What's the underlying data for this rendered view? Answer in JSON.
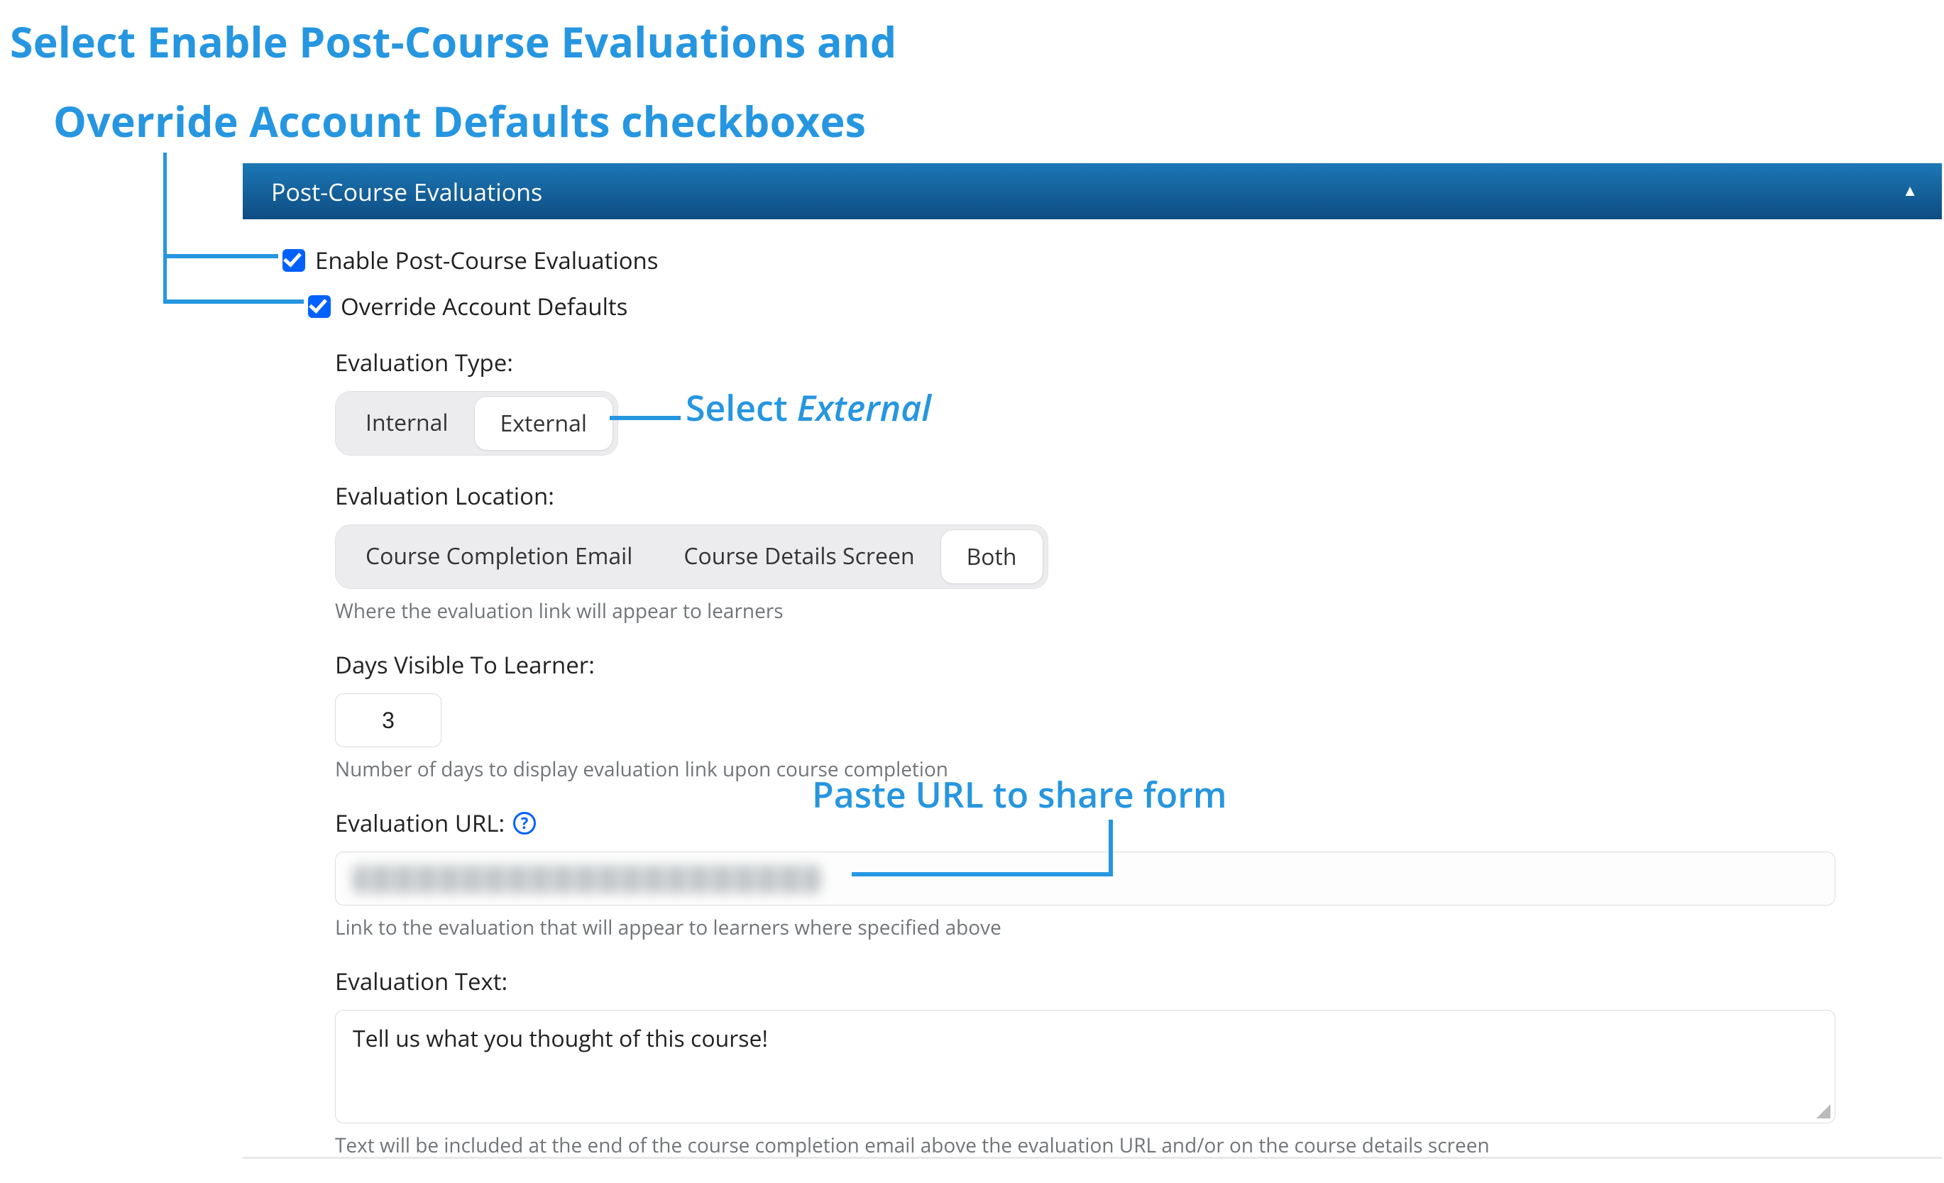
{
  "annotations": {
    "title_line1": "Select Enable Post-Course Evaluations and",
    "title_line2": "Override Account Defaults checkboxes",
    "select_external_prefix": "Select ",
    "select_external_em": "External",
    "paste_url": "Paste URL to share form"
  },
  "panel": {
    "title": "Post-Course Evaluations"
  },
  "checkboxes": {
    "enable_label": "Enable Post-Course Evaluations",
    "override_label": "Override Account Defaults"
  },
  "evaluation_type": {
    "label": "Evaluation Type:",
    "options": {
      "internal": "Internal",
      "external": "External"
    },
    "selected": "external"
  },
  "evaluation_location": {
    "label": "Evaluation Location:",
    "options": {
      "email": "Course Completion Email",
      "details": "Course Details Screen",
      "both": "Both"
    },
    "selected": "both",
    "help": "Where the evaluation link will appear to learners"
  },
  "days_visible": {
    "label": "Days Visible To Learner:",
    "value": "3",
    "help": "Number of days to display evaluation link upon course completion"
  },
  "evaluation_url": {
    "label": "Evaluation URL:",
    "value": "",
    "help": "Link to the evaluation that will appear to learners where specified above"
  },
  "evaluation_text": {
    "label": "Evaluation Text:",
    "value": "Tell us what you thought of this course!",
    "help": "Text will be included at the end of the course completion email above the evaluation URL and/or on the course details screen"
  }
}
